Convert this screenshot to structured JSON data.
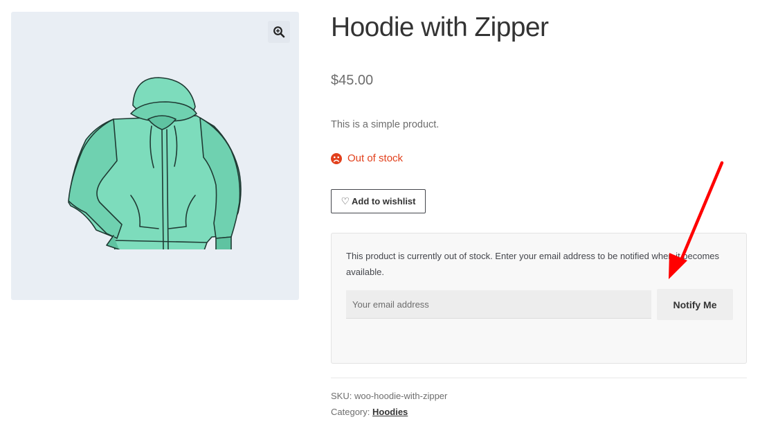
{
  "gallery": {
    "zoom_icon": "zoom-in-icon",
    "image_icon": "hoodie-illustration"
  },
  "product": {
    "title": "Hoodie with Zipper",
    "price": "$45.00",
    "description": "This is a simple product.",
    "stock_status": "Out of stock",
    "stock_icon": "sad-face-icon"
  },
  "wishlist": {
    "icon": "heart-outline-icon",
    "heart_glyph": "♡",
    "label": "Add to wishlist"
  },
  "notify": {
    "message": "This product is currently out of stock. Enter your email address to be notified when it becomes available.",
    "email_placeholder": "Your email address",
    "email_value": "",
    "button_label": "Notify Me"
  },
  "meta": {
    "sku_label": "SKU:",
    "sku_value": "woo-hoodie-with-zipper",
    "category_label": "Category:",
    "category_value": "Hoodies"
  },
  "colors": {
    "out_of_stock": "#e2401c",
    "annotation_arrow": "#ff0000",
    "hoodie": "#7ddcbc",
    "gallery_bg": "#e9eef4"
  }
}
